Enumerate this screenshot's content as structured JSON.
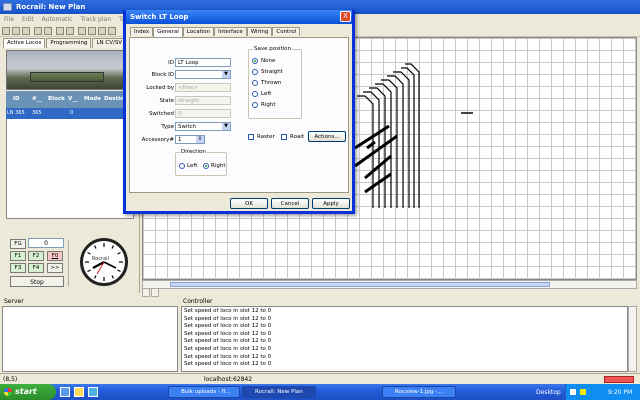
{
  "window": {
    "title": "Rocrail: New Plan"
  },
  "menu": [
    "File",
    "Edit",
    "Automatic",
    "Track plan",
    "Tables"
  ],
  "left_tabs": [
    "Active Locos",
    "Programming",
    "LN CV/SV"
  ],
  "loco_table": {
    "headers": [
      "ID",
      "#__",
      "Block",
      "V__",
      "Mode",
      "Destin"
    ],
    "row": [
      "LN 365",
      "365",
      "",
      "0",
      "",
      ""
    ]
  },
  "throttle": {
    "fg": "FG",
    "speed": "0",
    "f1": "F1",
    "f2": "F2",
    "f0": "F0",
    "f3": "F3",
    "f4": "F4",
    "more": ">>",
    "stop": "Stop",
    "clock_label": "Rocrail"
  },
  "bottom_tabs": [
    "",
    ""
  ],
  "server": {
    "label": "Server"
  },
  "controller": {
    "label": "Controller",
    "lines": [
      "Set speed of loco in slot 12 to 0",
      "Set speed of loco in slot 12 to 0",
      "Set speed of loco in slot 12 to 0",
      "Set speed of loco in slot 12 to 0",
      "Set speed of loco in slot 12 to 0",
      "Set speed of loco in slot 12 to 0",
      "Set speed of loco in slot 12 to 0",
      "Set speed of loco in slot 12 to 0"
    ]
  },
  "status": {
    "coords": "(8,5)",
    "host": "localhost:62842"
  },
  "taskbar": {
    "start": "start",
    "tasks": [
      "Bulk uploads - fl...",
      "Rocrail: New Plan",
      "Rocview-1.jpg -..."
    ],
    "desktop": "Desktop",
    "time": "9:20 PM"
  },
  "dialog": {
    "title": "Switch LT Loop",
    "close": "X",
    "tabs": [
      "Index",
      "General",
      "Location",
      "Interface",
      "Wiring",
      "Control"
    ],
    "fields": {
      "id_label": "ID",
      "id_value": "LT Loop",
      "block_label": "Block ID",
      "block_value": "",
      "locked_label": "Locked by",
      "locked_value": "<free>",
      "state_label": "State",
      "state_value": "straight",
      "switched_label": "Switched",
      "switched_value": "0",
      "type_label": "Type",
      "type_value": "Switch",
      "accessory_label": "Accessory#",
      "accessory_value": "1"
    },
    "direction": {
      "title": "Direction",
      "left": "Left",
      "right": "Right",
      "selected": "Right"
    },
    "save_position": {
      "title": "Save position",
      "options": [
        "None",
        "Straight",
        "Thrown",
        "Left",
        "Right"
      ],
      "selected": "None"
    },
    "raster": "Raster",
    "road": "Road",
    "actions": "Actions...",
    "ok": "OK",
    "cancel": "Cancel",
    "apply": "Apply"
  }
}
